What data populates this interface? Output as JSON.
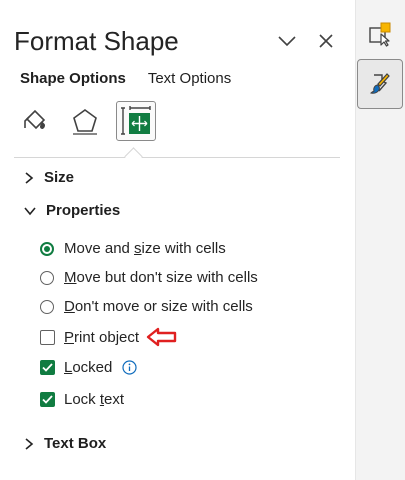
{
  "pane": {
    "title": "Format Shape",
    "tabs": {
      "shape_options": "Shape Options",
      "text_options": "Text Options"
    },
    "icons": [
      "fill-line-icon",
      "effects-icon",
      "size-properties-icon"
    ]
  },
  "sections": {
    "size": "Size",
    "properties": "Properties",
    "text_box": "Text Box"
  },
  "properties": {
    "radio1": {
      "pre": "Move and ",
      "u": "s",
      "post": "ize with cells",
      "selected": true
    },
    "radio2": {
      "pre": "",
      "u": "M",
      "post": "ove but don't size with cells",
      "selected": false
    },
    "radio3": {
      "pre": "",
      "u": "D",
      "post": "on't move or size with cells",
      "selected": false
    },
    "print_object": {
      "pre": "",
      "u": "P",
      "post": "rint object",
      "checked": false
    },
    "locked": {
      "pre": "",
      "u": "L",
      "post": "ocked",
      "checked": true
    },
    "lock_text": {
      "pre": "Lock ",
      "u": "t",
      "post": "ext",
      "checked": true
    }
  },
  "colors": {
    "accent": "#107c41",
    "annotation_arrow": "#e02020",
    "info": "#0f6cbd"
  }
}
